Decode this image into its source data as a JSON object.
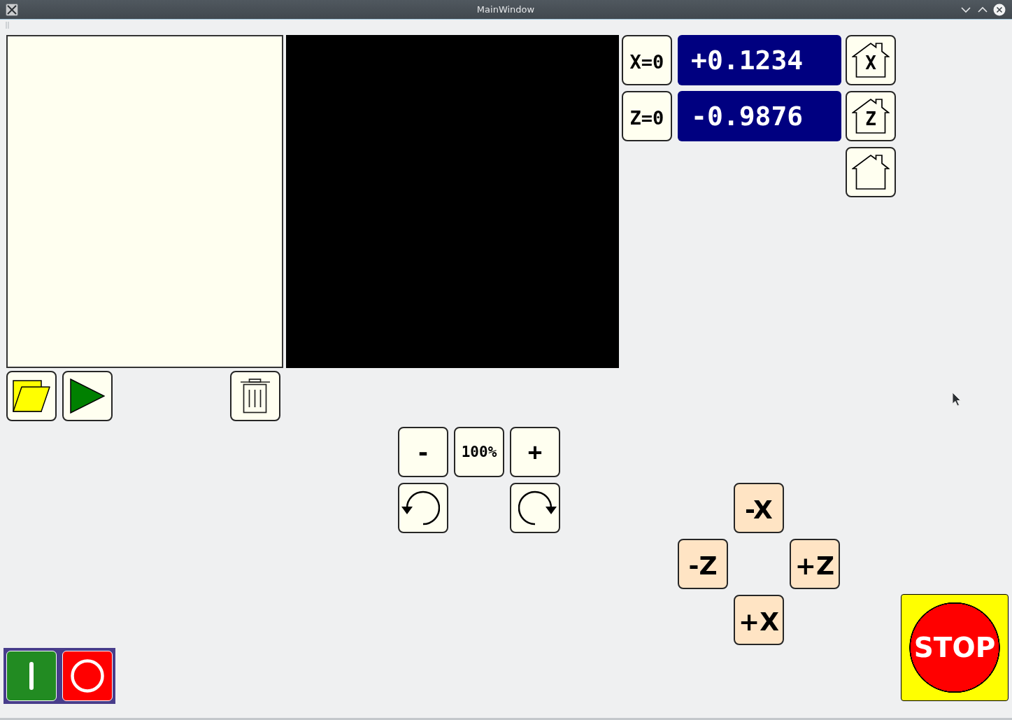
{
  "window": {
    "title": "MainWindow"
  },
  "axes": [
    {
      "zero_button": "X=0",
      "reading": "+0.1234",
      "home_button": "X"
    },
    {
      "zero_button": "Z=0",
      "reading": "-0.9876",
      "home_button": "Z"
    }
  ],
  "zoom_controls": {
    "zoom_out": "-",
    "zoom_reset": "100%",
    "zoom_in": "+"
  },
  "jog_controls": {
    "minus_x": "-X",
    "minus_z": "-Z",
    "plus_z": "+Z",
    "plus_x": "+X"
  },
  "stop_button": {
    "label": "STOP"
  }
}
